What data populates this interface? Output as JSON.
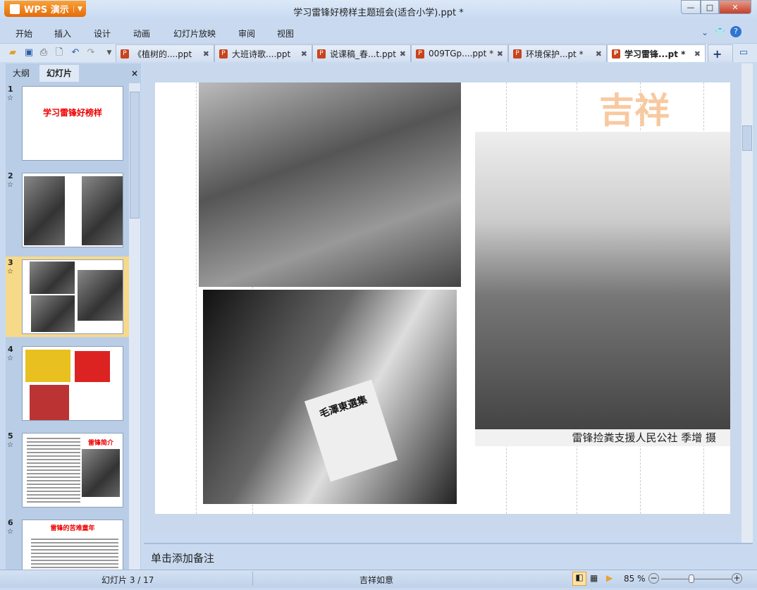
{
  "app": {
    "button_label": "WPS 演示",
    "title": "学习雷锋好榜样主题班会(适合小学).ppt *"
  },
  "window_controls": {
    "minimize": "—",
    "maximize": "□",
    "close": "✕"
  },
  "menu": [
    "开始",
    "插入",
    "设计",
    "动画",
    "幻灯片放映",
    "审阅",
    "视图"
  ],
  "toolbar_icons": [
    "open-folder-icon",
    "save-icon",
    "print-icon",
    "print-preview-icon",
    "undo-icon",
    "redo-icon",
    "customize-dropdown-icon"
  ],
  "tabs": [
    {
      "label": "《植树的....ppt",
      "active": false
    },
    {
      "label": "大班诗歌....ppt",
      "active": false
    },
    {
      "label": "说课稿_春...t.ppt",
      "active": false
    },
    {
      "label": "009TGp....ppt *",
      "active": false
    },
    {
      "label": "环境保护...pt *",
      "active": false
    },
    {
      "label": "学习雷锋...pt *",
      "active": true
    }
  ],
  "panel": {
    "tabs": [
      "大纲",
      "幻灯片"
    ],
    "active_tab": "幻灯片",
    "close": "×"
  },
  "thumbnails": [
    {
      "num": "1",
      "title": "学习雷锋好榜样"
    },
    {
      "num": "2",
      "title": ""
    },
    {
      "num": "3",
      "title": "",
      "selected": true
    },
    {
      "num": "4",
      "title": ""
    },
    {
      "num": "5",
      "title": "雷锋简介"
    },
    {
      "num": "6",
      "title": "雷锋的苦难童年"
    }
  ],
  "slide": {
    "caption": "雷锋捡粪支援人民公社 季增 摄",
    "book_title": "毛澤東選集",
    "watermark": "吉祥"
  },
  "notes": {
    "placeholder": "单击添加备注"
  },
  "status": {
    "slide_indicator": "幻灯片 3 / 17",
    "theme": "吉祥如意",
    "zoom": "85 %",
    "zoom_percent": 85
  },
  "colors": {
    "accent": "#e97a14",
    "selected_thumb": "#f7d98a",
    "title_red": "#e00000"
  }
}
